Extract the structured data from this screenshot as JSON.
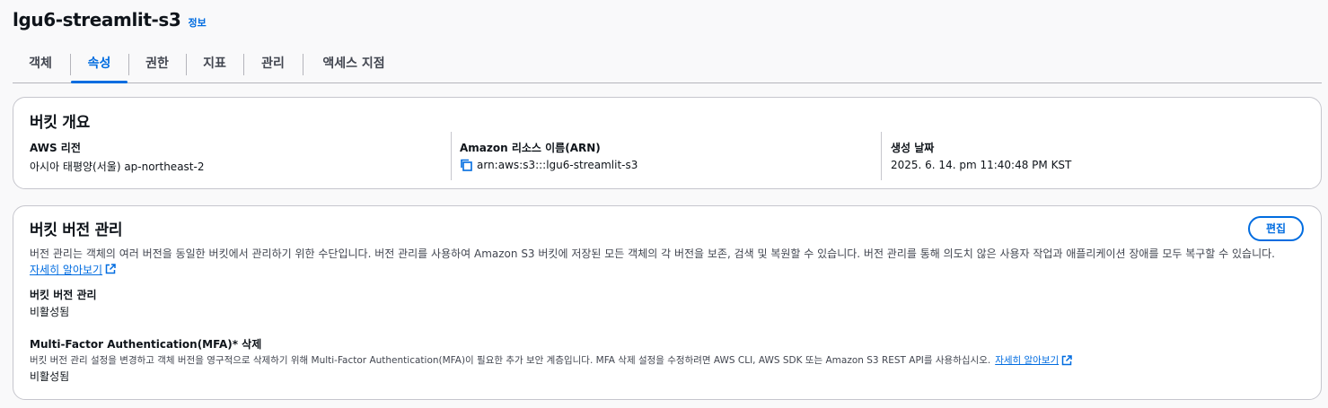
{
  "header": {
    "bucket_name": "lgu6-streamlit-s3",
    "info_label": "정보"
  },
  "tabs": [
    {
      "label": "객체"
    },
    {
      "label": "속성",
      "active": true
    },
    {
      "label": "권한"
    },
    {
      "label": "지표"
    },
    {
      "label": "관리"
    },
    {
      "label": "액세스 지점"
    }
  ],
  "overview": {
    "title": "버킷 개요",
    "region_label": "AWS 리전",
    "region_value": "아시아 태평양(서울) ap-northeast-2",
    "arn_label": "Amazon 리소스 이름(ARN)",
    "arn_value": "arn:aws:s3:::lgu6-streamlit-s3",
    "created_label": "생성 날짜",
    "created_value": "2025. 6. 14. pm 11:40:48 PM KST"
  },
  "versioning": {
    "title": "버킷 버전 관리",
    "edit_label": "편집",
    "description": "버전 관리는 객체의 여러 버전을 동일한 버킷에서 관리하기 위한 수단입니다. 버전 관리를 사용하여 Amazon S3 버킷에 저장된 모든 객체의 각 버전을 보존, 검색 및 복원할 수 있습니다. 버전 관리를 통해 의도치 않은 사용자 작업과 애플리케이션 장애를 모두 복구할 수 있습니다.",
    "learn_more": "자세히 알아보기",
    "versioning_label": "버킷 버전 관리",
    "versioning_value": "비활성됨",
    "mfa_label": "Multi-Factor Authentication(MFA)* 삭제",
    "mfa_description": "버킷 버전 관리 설정을 변경하고 객체 버전을 영구적으로 삭제하기 위해 Multi-Factor Authentication(MFA)이 필요한 추가 보안 계층입니다. MFA 삭제 설정을 수정하려면 AWS CLI, AWS SDK 또는 Amazon S3 REST API를 사용하십시오.",
    "mfa_learn_more": "자세히 알아보기",
    "mfa_value": "비활성됨"
  },
  "colors": {
    "accent": "#006ce0",
    "border": "#c6c6cd",
    "text": "#0f141a"
  },
  "icons": [
    "copy-icon",
    "external-link-icon"
  ]
}
